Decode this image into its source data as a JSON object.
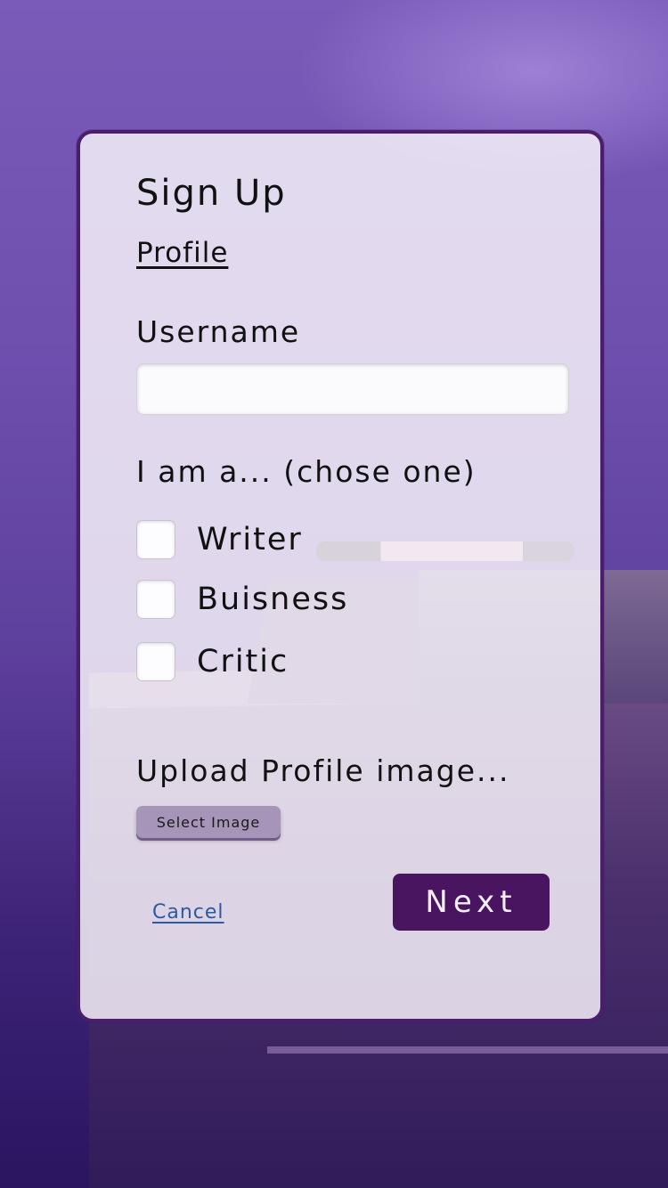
{
  "form": {
    "title": "Sign Up",
    "subtitle": "Profile",
    "username_label": "Username",
    "username_value": "",
    "role_prompt": "I am a... (chose one)",
    "roles": [
      {
        "label": "Writer",
        "checked": false
      },
      {
        "label": "Buisness",
        "checked": false
      },
      {
        "label": "Critic",
        "checked": false
      }
    ],
    "upload_label": "Upload Profile image...",
    "select_image_label": "Select Image",
    "cancel_label": "Cancel",
    "next_label": "Next"
  },
  "colors": {
    "card_border": "#4a1e6a",
    "next_button": "#4a1560",
    "select_button": "#a695b8",
    "link": "#2c5aa0",
    "background": "#6e4fae"
  }
}
